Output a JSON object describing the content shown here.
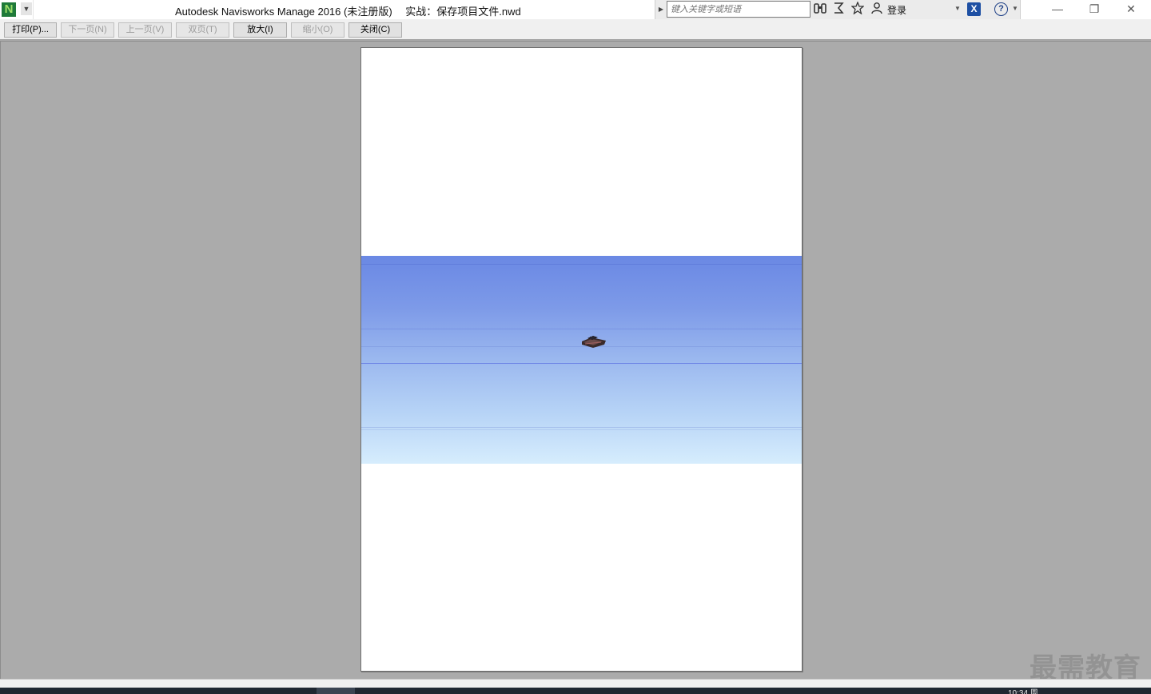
{
  "window": {
    "title": "Autodesk Navisworks Manage 2016 (未注册版)　 实战：保存项目文件.nwd",
    "app_icon_letter": "N"
  },
  "infocenter": {
    "search_placeholder": "键入关键字或短语",
    "login_label": "登录",
    "exchange_letter": "X",
    "help_glyph": "?"
  },
  "toolbar": {
    "print": "打印(P)...",
    "next_page": "下一页(N)",
    "prev_page": "上一页(V)",
    "two_page": "双页(T)",
    "zoom_in": "放大(I)",
    "zoom_out": "缩小(O)",
    "close": "关闭(C)"
  },
  "watermark": "最需教育",
  "taskbar": {
    "clock": "10:34 周"
  },
  "colors": {
    "sky_top": "#6a88e4",
    "sky_bottom": "#d6edfd",
    "workspace_gray": "#ababab",
    "exchange_blue": "#1d4fa3"
  },
  "icons": [
    "navisworks-logo-icon",
    "binoculars-icon",
    "subscription-icon",
    "favorites-star-icon",
    "user-icon",
    "exchange-icon",
    "help-icon",
    "minimize-icon",
    "restore-icon",
    "close-icon"
  ]
}
